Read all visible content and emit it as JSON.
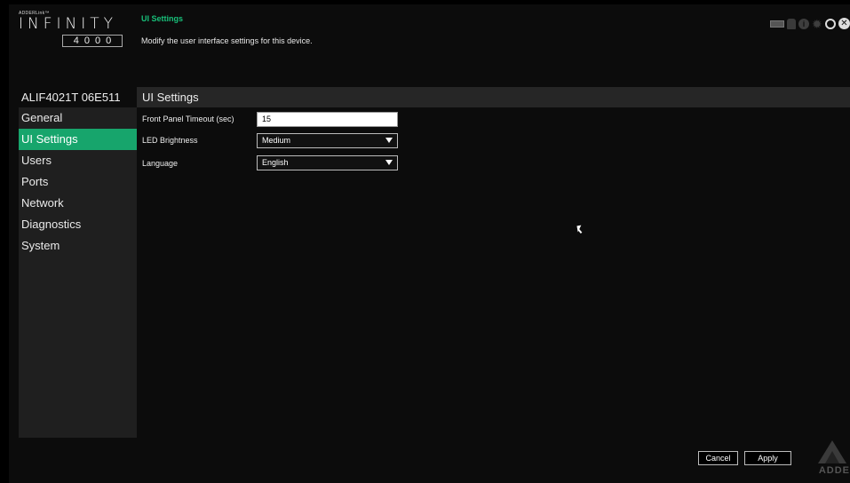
{
  "logo": {
    "brand_small": "ADDERLink™",
    "brand_big": "INFINITY",
    "model": "4000"
  },
  "header": {
    "title": "UI Settings",
    "description": "Modify the user interface settings for this device.",
    "icons": [
      "keyboard-icon",
      "lock-icon",
      "info-icon",
      "gear-icon",
      "refresh-icon",
      "close-icon"
    ]
  },
  "sidebar": {
    "device_name": "ALIF4021T 06E511",
    "items": [
      {
        "label": "General"
      },
      {
        "label": "UI Settings"
      },
      {
        "label": "Users"
      },
      {
        "label": "Ports"
      },
      {
        "label": "Network"
      },
      {
        "label": "Diagnostics"
      },
      {
        "label": "System"
      }
    ],
    "active_index": 1
  },
  "panel": {
    "title": "UI Settings",
    "fields": [
      {
        "label": "Front Panel Timeout (sec)",
        "value": "15",
        "type": "text"
      },
      {
        "label": "LED Brightness",
        "value": "Medium",
        "type": "select"
      },
      {
        "label": "Language",
        "value": "English",
        "type": "select"
      }
    ]
  },
  "buttons": {
    "cancel": "Cancel",
    "apply": "Apply"
  },
  "corner_logo": {
    "word": "ADDE"
  },
  "colors": {
    "accent": "#17a56c",
    "header_title": "#18c07a"
  }
}
